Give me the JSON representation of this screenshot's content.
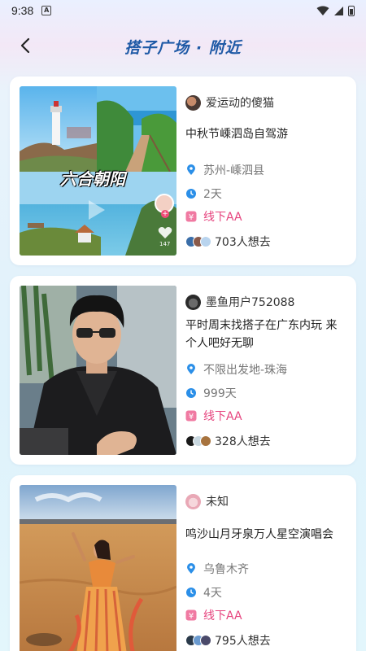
{
  "status_bar": {
    "time": "9:38",
    "notif_letter": "A"
  },
  "header": {
    "title": "搭子广场 · 附近"
  },
  "posts": [
    {
      "author": "爱运动的傻猫",
      "title": "中秋节嵊泗岛自驾游",
      "location": "苏州-嵊泗县",
      "duration": "2天",
      "mode": "线下AA",
      "want": "703人想去",
      "image_caption": "六合朝阳",
      "image_like_count": "147"
    },
    {
      "author": "墨鱼用户752088",
      "title": "平时周末找搭子在广东内玩 来个人吧好无聊",
      "location": "不限出发地-珠海",
      "duration": "999天",
      "mode": "线下AA",
      "want": "328人想去"
    },
    {
      "author": "未知",
      "title": "鸣沙山月牙泉万人星空演唱会",
      "location": "乌鲁木齐",
      "duration": "4天",
      "mode": "线下AA",
      "want": "795人想去"
    }
  ],
  "colors": {
    "title_blue": "#1f5aa6",
    "icon_blue": "#2b8fe8",
    "aa_pink": "#e6447e"
  }
}
